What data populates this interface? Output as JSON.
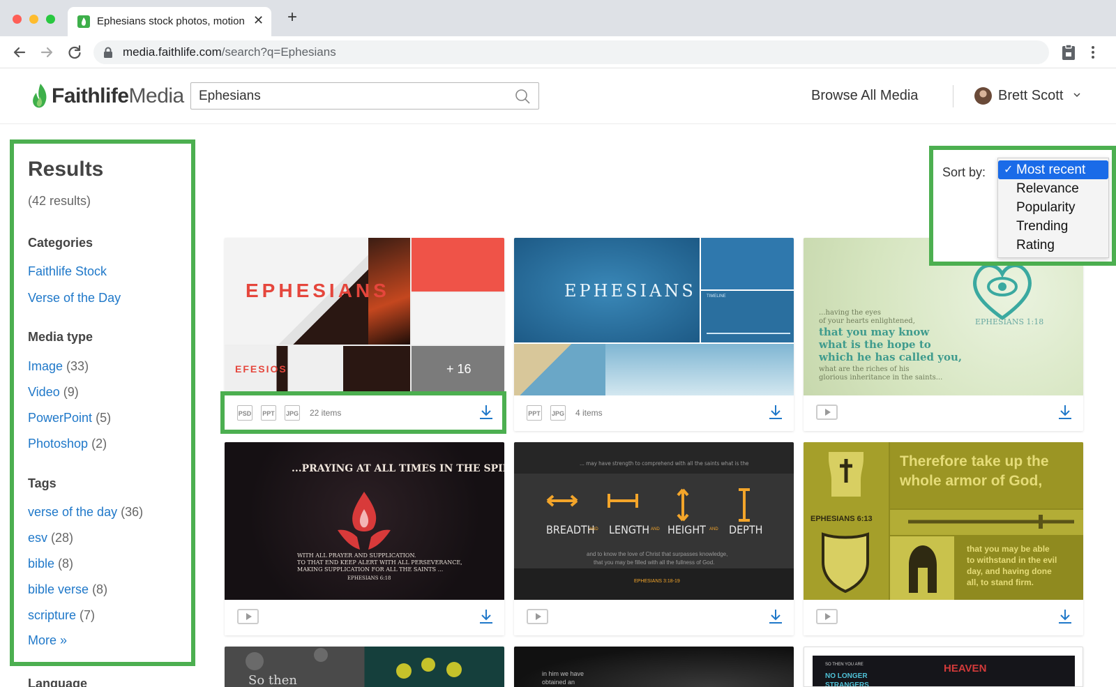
{
  "browser": {
    "tab_title": "Ephesians stock photos, motion",
    "url_host": "media.faithlife.com",
    "url_path": "/search?q=Ephesians"
  },
  "header": {
    "logo_bold": "Faithlife",
    "logo_light": "Media",
    "search_value": "Ephesians",
    "browse_label": "Browse All Media",
    "user_name": "Brett Scott"
  },
  "sidebar": {
    "title": "Results",
    "count": "(42 results)",
    "categories_heading": "Categories",
    "categories": [
      {
        "label": "Faithlife Stock"
      },
      {
        "label": "Verse of the Day"
      }
    ],
    "media_heading": "Media type",
    "media_types": [
      {
        "label": "Image",
        "count": "(33)"
      },
      {
        "label": "Video",
        "count": "(9)"
      },
      {
        "label": "PowerPoint",
        "count": "(5)"
      },
      {
        "label": "Photoshop",
        "count": "(2)"
      }
    ],
    "tags_heading": "Tags",
    "tags": [
      {
        "label": "verse of the day",
        "count": "(36)"
      },
      {
        "label": "esv",
        "count": "(28)"
      },
      {
        "label": "bible",
        "count": "(8)"
      },
      {
        "label": "bible verse",
        "count": "(8)"
      },
      {
        "label": "scripture",
        "count": "(7)"
      }
    ],
    "more_label": "More »",
    "language_heading": "Language"
  },
  "sort": {
    "label": "Sort by:",
    "check": "✓",
    "options": [
      "Most recent",
      "Relevance",
      "Popularity",
      "Trending",
      "Rating"
    ],
    "selected": "Most recent"
  },
  "cards": {
    "c1": {
      "title": "EPHESIANS",
      "subtitle": "EFESIOS",
      "more": "+ 16",
      "formats": [
        "PSD",
        "PPT",
        "JPG"
      ],
      "items": "22 items"
    },
    "c2": {
      "title": "EPHESIANS",
      "timeline": "TIMELINE",
      "formats": [
        "PPT",
        "JPG"
      ],
      "items": "4 items"
    },
    "c3": {
      "line1": "...having the eyes",
      "line2": "of your hearts enlightened,",
      "line3": "that you may know",
      "line4": "what is the hope to",
      "line5": "which he has called you,",
      "line6": "what are the riches of his",
      "line7": "glorious inheritance in the saints...",
      "ref": "EPHESIANS 1:18"
    },
    "c4": {
      "headline": "...PRAYING AT ALL TIMES IN THE SPIRIT,",
      "body1": "WITH ALL PRAYER AND SUPPLICATION.",
      "body2": "TO THAT END KEEP ALERT WITH ALL PERSEVERANCE,",
      "body3": "MAKING SUPPLICATION FOR ALL THE SAINTS ...",
      "ref": "EPHESIANS 6:18"
    },
    "c5": {
      "top": "... may have strength to comprehend with all the saints what is the",
      "w1": "BREADTH",
      "w2": "LENGTH",
      "w3": "HEIGHT",
      "w4": "DEPTH",
      "and": "AND",
      "body1": "and to know the love of Christ that surpasses knowledge,",
      "body2": "that you may be filled with all the fullness of God.",
      "ref": "EPHESIANS 3:18-19"
    },
    "c6": {
      "headline1": "Therefore take up the",
      "headline2": "whole armor of God,",
      "ref": "EPHESIANS 6:13",
      "body1": "that you may be able",
      "body2": "to withstand in the evil",
      "body3": "day, and having done",
      "body4": "all, to stand firm."
    },
    "c7": {
      "text": "So then"
    },
    "c8": {
      "line1": "in him we have",
      "line2": "obtained an"
    },
    "c9": {
      "small": "SO THEN YOU ARE",
      "green": "NO LONGER",
      "green2": "STRANGERS",
      "red": "HEAVEN"
    }
  },
  "colors": {
    "highlight": "#4caf50",
    "link": "#1f78c9",
    "download": "#1f78c9",
    "sort_selected": "#1a6be8"
  }
}
